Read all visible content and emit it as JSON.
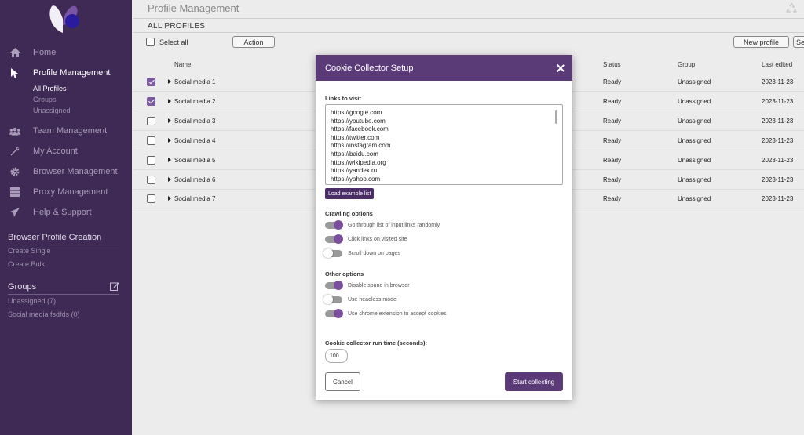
{
  "sidebar": {
    "nav": [
      {
        "label": "Home",
        "icon": "home-icon"
      },
      {
        "label": "Profile Management",
        "icon": "cursor-icon",
        "active": true
      },
      {
        "label": "Team Management",
        "icon": "team-icon"
      },
      {
        "label": "My Account",
        "icon": "wrench-icon"
      },
      {
        "label": "Browser Management",
        "icon": "gear-icon"
      },
      {
        "label": "Proxy Management",
        "icon": "server-icon"
      },
      {
        "label": "Help & Support",
        "icon": "paper-plane-icon"
      }
    ],
    "profile_sub": [
      "All Profiles",
      "Groups",
      "Unassigned"
    ],
    "browser_profile_creation": {
      "title": "Browser Profile Creation",
      "links": [
        "Create Single",
        "Create Bulk"
      ]
    },
    "groups": {
      "title": "Groups",
      "items": [
        "Unassigned (7)",
        "Social media fsdfds (0)"
      ]
    }
  },
  "main": {
    "title": "Profile Management",
    "subtitle": "ALL PROFILES",
    "select_all": "Select all",
    "action_button": "Action",
    "new_profile_button": "New profile",
    "se_button": "Se",
    "columns": {
      "name": "Name",
      "status": "Status",
      "group": "Group",
      "last_edited": "Last edited"
    },
    "rows": [
      {
        "name": "Social media 1",
        "status": "Ready",
        "group": "Unassigned",
        "date": "2023-11-23",
        "checked": true
      },
      {
        "name": "Social media 2",
        "status": "Ready",
        "group": "Unassigned",
        "date": "2023-11-23",
        "checked": true
      },
      {
        "name": "Social media 3",
        "status": "Ready",
        "group": "Unassigned",
        "date": "2023-11-23",
        "checked": false
      },
      {
        "name": "Social media 4",
        "status": "Ready",
        "group": "Unassigned",
        "date": "2023-11-23",
        "checked": false
      },
      {
        "name": "Social media 5",
        "status": "Ready",
        "group": "Unassigned",
        "date": "2023-11-23",
        "checked": false
      },
      {
        "name": "Social media 6",
        "status": "Ready",
        "group": "Unassigned",
        "date": "2023-11-23",
        "checked": false
      },
      {
        "name": "Social media 7",
        "status": "Ready",
        "group": "Unassigned",
        "date": "2023-11-23",
        "checked": false
      }
    ]
  },
  "dialog": {
    "title": "Cookie Collector Setup",
    "links_label": "Links to visit",
    "links": [
      "https://google.com",
      "https://youtube.com",
      "https://facebook.com",
      "https://twitter.com",
      "https://instagram.com",
      "https://baidu.com",
      "https://wikipedia.org",
      "https://yandex.ru",
      "https://yahoo.com"
    ],
    "load_example_button": "Load example list",
    "crawling_label": "Crawling options",
    "crawling_options": [
      {
        "label": "Go through list of input links randomly",
        "on": true
      },
      {
        "label": "Click links on visited site",
        "on": true
      },
      {
        "label": "Scroll down on pages",
        "on": false
      }
    ],
    "other_label": "Other options",
    "other_options": [
      {
        "label": "Disable sound in browser",
        "on": true
      },
      {
        "label": "Use headless mode",
        "on": false
      },
      {
        "label": "Use chrome extension to accept cookies",
        "on": true
      }
    ],
    "runtime_label": "Cookie collector run time (seconds):",
    "runtime_value": "100",
    "cancel_button": "Cancel",
    "start_button": "Start collecting"
  },
  "colors": {
    "sidebar": "#3f2a55",
    "accent": "#5a3b78",
    "toggle_knob": "#7b4f9e"
  }
}
